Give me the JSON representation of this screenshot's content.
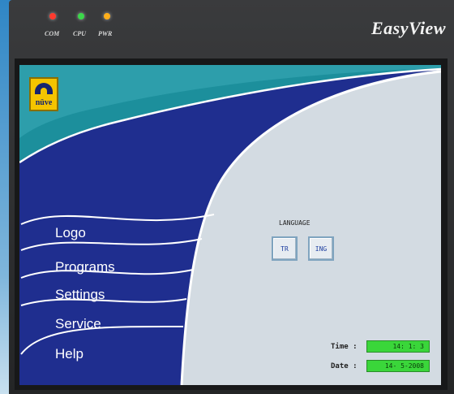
{
  "device": {
    "brand": "EasyView",
    "leds": [
      {
        "label": "COM",
        "color": "#ff3a2e"
      },
      {
        "label": "CPU",
        "color": "#3bd84a"
      },
      {
        "label": "PWR",
        "color": "#ffae1a"
      }
    ]
  },
  "logo": {
    "text": "nüve"
  },
  "menu": {
    "items": [
      {
        "label": "Logo"
      },
      {
        "label": "Programs"
      },
      {
        "label": "Settings"
      },
      {
        "label": "Service"
      },
      {
        "label": "Help"
      }
    ]
  },
  "language": {
    "label": "LANGUAGE",
    "options": [
      {
        "label": "TR"
      },
      {
        "label": "ING"
      }
    ]
  },
  "status": {
    "time_label": "Time :",
    "time_value": "14: 1: 3",
    "date_label": "Date :",
    "date_value": "14- 5-2008"
  },
  "colors": {
    "menu_panel": "#1f2e8f",
    "teal_band": "#1c8f9c",
    "content_bg": "#d3dbe2",
    "value_bg": "#3ad63a"
  }
}
